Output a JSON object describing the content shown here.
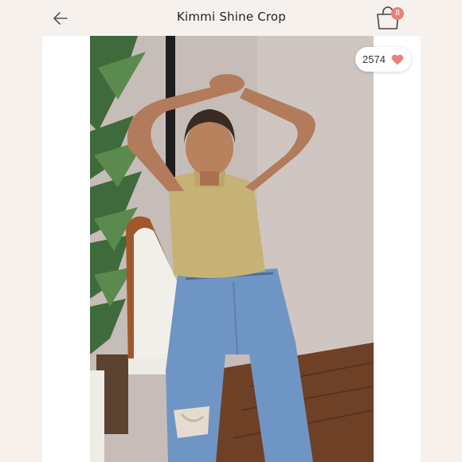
{
  "header": {
    "title": "Kimmi Shine Crop",
    "back_icon": "arrow-left-icon",
    "bag_icon": "shopping-bag-icon",
    "bag_count": "8"
  },
  "likes": {
    "count": "2574",
    "icon": "heart-icon",
    "color": "#e8817a"
  },
  "colors": {
    "accent": "#e8817a",
    "topbar_bg": "#f7f1ed",
    "outer_bg": "#f6f1ec"
  }
}
